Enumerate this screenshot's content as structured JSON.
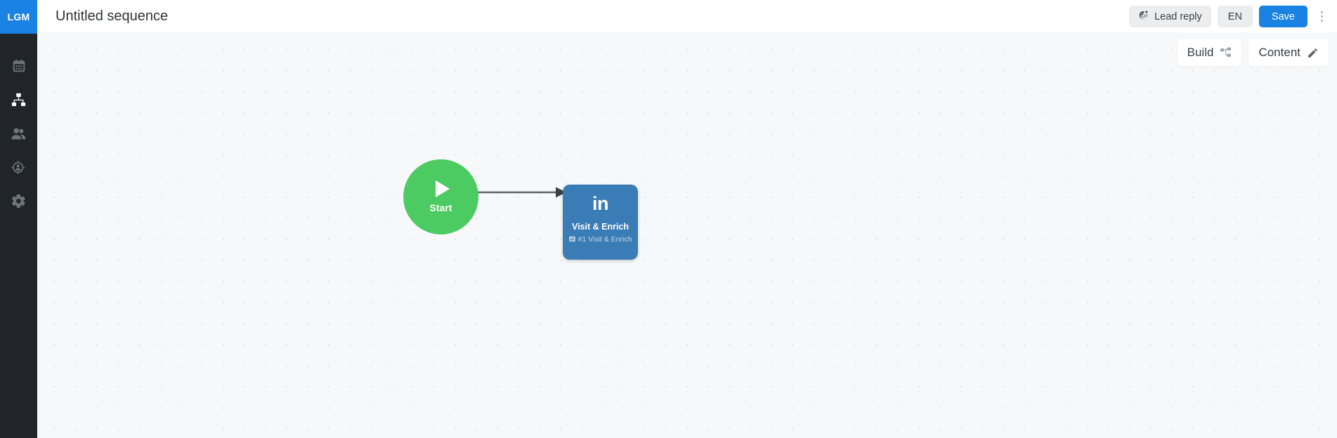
{
  "sidebar": {
    "logo_text": "LGM",
    "items": [
      {
        "icon": "calendar-icon",
        "active": false
      },
      {
        "icon": "sitemap-icon",
        "active": true
      },
      {
        "icon": "people-icon",
        "active": false
      },
      {
        "icon": "target-person-icon",
        "active": false
      },
      {
        "icon": "gear-icon",
        "active": false
      }
    ]
  },
  "header": {
    "title": "Untitled sequence",
    "lead_reply_label": "Lead reply",
    "lead_reply_icon": "bullseye-target-icon",
    "language_label": "EN",
    "save_label": "Save",
    "more_icon": "kebab-menu-icon"
  },
  "canvas": {
    "tabs": [
      {
        "label": "Build",
        "icon": "sitemap-icon"
      },
      {
        "label": "Content",
        "icon": "pencil-icon"
      }
    ],
    "nodes": [
      {
        "type": "start",
        "label": "Start",
        "icon": "play-icon",
        "color": "#4ccb63"
      },
      {
        "type": "step",
        "channel_icon": "linkedin-icon",
        "channel_text": "in",
        "title": "Visit & Enrich",
        "subtitle": "#1 Visit & Enrich",
        "subtitle_icon": "chart-icon",
        "color": "#3a7cb5"
      }
    ],
    "connector": {
      "from": "start",
      "to": "step",
      "arrow": "arrow-right"
    }
  },
  "colors": {
    "brand_blue": "#1a82e2",
    "sidebar_dark": "#212529",
    "canvas_bg": "#f7f8fa",
    "start_green": "#4ccb63",
    "node_blue": "#3a7cb5",
    "connector_grey": "#5a6268"
  }
}
